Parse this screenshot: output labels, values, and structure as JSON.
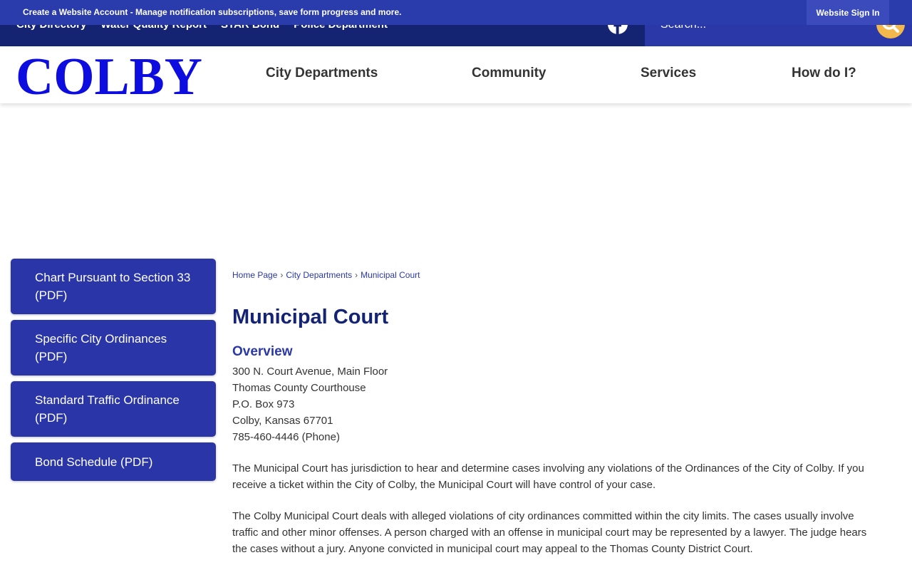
{
  "utility": {
    "links": [
      "City Directory",
      "Water Quality Report",
      "STAR Bond",
      "Police Department"
    ],
    "search_placeholder": "Search..."
  },
  "notification": {
    "text": "Create a Website Account - Manage notification subscriptions, save form progress and more.",
    "signin_label": "Website Sign In"
  },
  "header": {
    "logo_text": "COLBY",
    "nav": [
      "City Departments",
      "Community",
      "Services",
      "How do I?"
    ]
  },
  "sidebar": {
    "items": [
      "Chart Pursuant to Section 33 (PDF)",
      "Specific City Ordinances (PDF)",
      "Standard Traffic Ordinance (PDF)",
      "Bond Schedule (PDF)"
    ]
  },
  "breadcrumb": {
    "items": [
      "Home Page",
      "City Departments",
      "Municipal Court"
    ],
    "separator": "›"
  },
  "content": {
    "title": "Municipal Court",
    "section_title": "Overview",
    "address_lines": [
      "300 N. Court Avenue, Main Floor",
      "Thomas County Courthouse",
      "P.O. Box 973",
      "Colby, Kansas 67701",
      "785-460-4446 (Phone)"
    ],
    "paragraphs": [
      "The Municipal Court has jurisdiction to hear and determine cases involving any violations of the Ordinances of the City of Colby. If you receive a ticket within the City of Colby, the Municipal Court will have control of your case.",
      "The Colby Municipal Court deals with alleged violations of city ordinances committed within the city limits. The cases usually involve traffic and other minor offenses. A person charged with an offense in municipal court may be represented by a lawyer. The judge hears the cases without a jury. Anyone convicted in municipal court may appeal to the Thomas County District Court."
    ]
  },
  "colors": {
    "brand_dark": "#142372",
    "brand": "#2a38a8",
    "logo_blue": "#0d0de0",
    "search_accent": "#f2b84b"
  },
  "icons": {
    "social": "facebook-icon",
    "search": "search-icon"
  }
}
